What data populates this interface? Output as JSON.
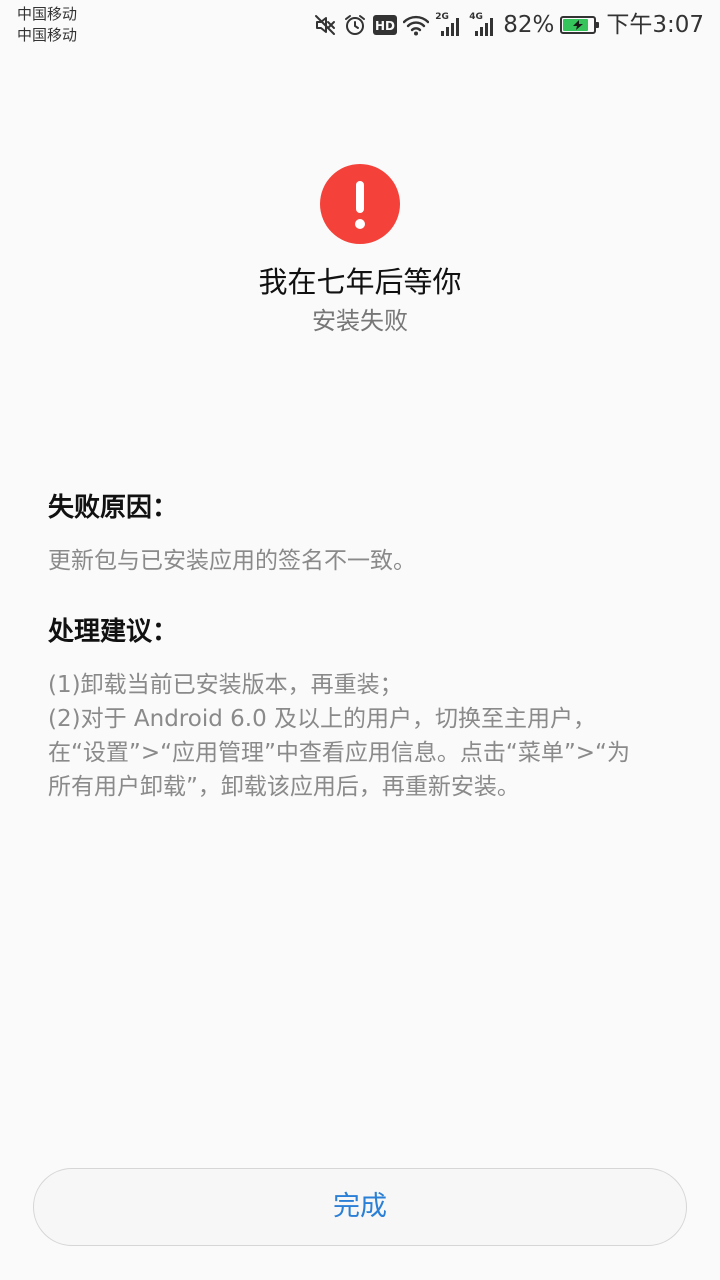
{
  "status_bar": {
    "carrier_1": "中国移动",
    "carrier_2": "中国移动",
    "hd_label": "HD",
    "sim1_network": "2G",
    "sim2_network": "4G",
    "battery_percent": "82%",
    "battery_level": 0.82,
    "time": "下午3:07",
    "icons": [
      "mute-icon",
      "alarm-icon",
      "hd-icon",
      "wifi-icon",
      "signal-icon",
      "signal-icon",
      "battery-charging-icon"
    ]
  },
  "header": {
    "icon": "exclamation-icon",
    "icon_color": "#f4413a",
    "app_name": "我在七年后等你",
    "status": "安装失败"
  },
  "reason": {
    "title": "失败原因：",
    "text": "更新包与已安装应用的签名不一致。"
  },
  "advice": {
    "title": "处理建议：",
    "lines": [
      "(1)卸载当前已安装版本，再重装；",
      "(2)对于 Android 6.0 及以上的用户，切换至主用户，",
      "在“设置”>“应用管理”中查看应用信息。点击“菜单”>“为",
      "所有用户卸载”，卸载该应用后，再重新安装。"
    ]
  },
  "footer": {
    "done_label": "完成",
    "accent_color": "#2a7fd6"
  }
}
